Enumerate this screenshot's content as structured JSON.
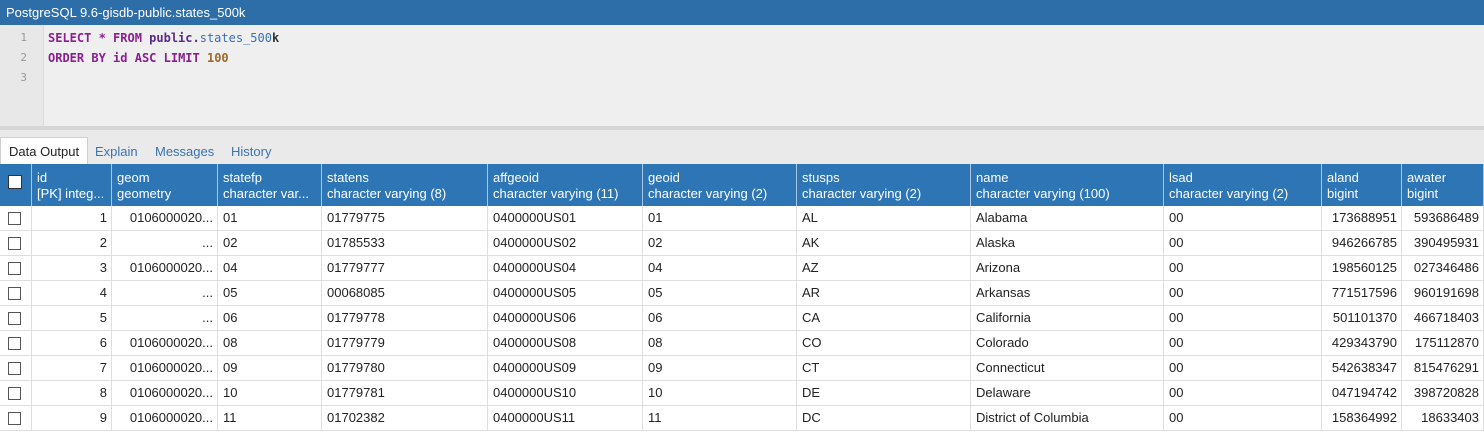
{
  "window": {
    "title": "PostgreSQL 9.6-gisdb-public.states_500k"
  },
  "editor": {
    "line_numbers": [
      "1",
      "2",
      "3"
    ],
    "line1": {
      "kw1": "SELECT * FROM ",
      "schema": "public.",
      "table": "states_500",
      "tail": "k"
    },
    "line2": {
      "kw1": "ORDER BY ",
      "col": "id ",
      "kw2": "ASC LIMIT ",
      "num": "100"
    }
  },
  "tabs": [
    "Data Output",
    "Explain",
    "Messages",
    "History"
  ],
  "active_tab": "Data Output",
  "columns": [
    {
      "name": "id",
      "type": "[PK] integ..."
    },
    {
      "name": "geom",
      "type": "geometry"
    },
    {
      "name": "statefp",
      "type": "character var..."
    },
    {
      "name": "statens",
      "type": "character varying (8)"
    },
    {
      "name": "affgeoid",
      "type": "character varying (11)"
    },
    {
      "name": "geoid",
      "type": "character varying (2)"
    },
    {
      "name": "stusps",
      "type": "character varying (2)"
    },
    {
      "name": "name",
      "type": "character varying (100)"
    },
    {
      "name": "lsad",
      "type": "character varying (2)"
    },
    {
      "name": "aland",
      "type": "bigint"
    },
    {
      "name": "awater",
      "type": "bigint"
    }
  ],
  "rows": [
    [
      "1",
      "0106000020...",
      "01",
      "01779775",
      "0400000US01",
      "01",
      "AL",
      "Alabama",
      "00",
      "173688951",
      "593686489"
    ],
    [
      "2",
      "...",
      "02",
      "01785533",
      "0400000US02",
      "02",
      "AK",
      "Alaska",
      "00",
      "946266785",
      "390495931"
    ],
    [
      "3",
      "0106000020...",
      "04",
      "01779777",
      "0400000US04",
      "04",
      "AZ",
      "Arizona",
      "00",
      "198560125",
      "027346486"
    ],
    [
      "4",
      "...",
      "05",
      "00068085",
      "0400000US05",
      "05",
      "AR",
      "Arkansas",
      "00",
      "771517596",
      "960191698"
    ],
    [
      "5",
      "...",
      "06",
      "01779778",
      "0400000US06",
      "06",
      "CA",
      "California",
      "00",
      "501101370",
      "466718403"
    ],
    [
      "6",
      "0106000020...",
      "08",
      "01779779",
      "0400000US08",
      "08",
      "CO",
      "Colorado",
      "00",
      "429343790",
      "175112870"
    ],
    [
      "7",
      "0106000020...",
      "09",
      "01779780",
      "0400000US09",
      "09",
      "CT",
      "Connecticut",
      "00",
      "542638347",
      "815476291"
    ],
    [
      "8",
      "0106000020...",
      "10",
      "01779781",
      "0400000US10",
      "10",
      "DE",
      "Delaware",
      "00",
      "047194742",
      "398720828"
    ],
    [
      "9",
      "0106000020...",
      "11",
      "01702382",
      "0400000US11",
      "11",
      "DC",
      "District of Columbia",
      "00",
      "158364992",
      "18633403"
    ]
  ]
}
